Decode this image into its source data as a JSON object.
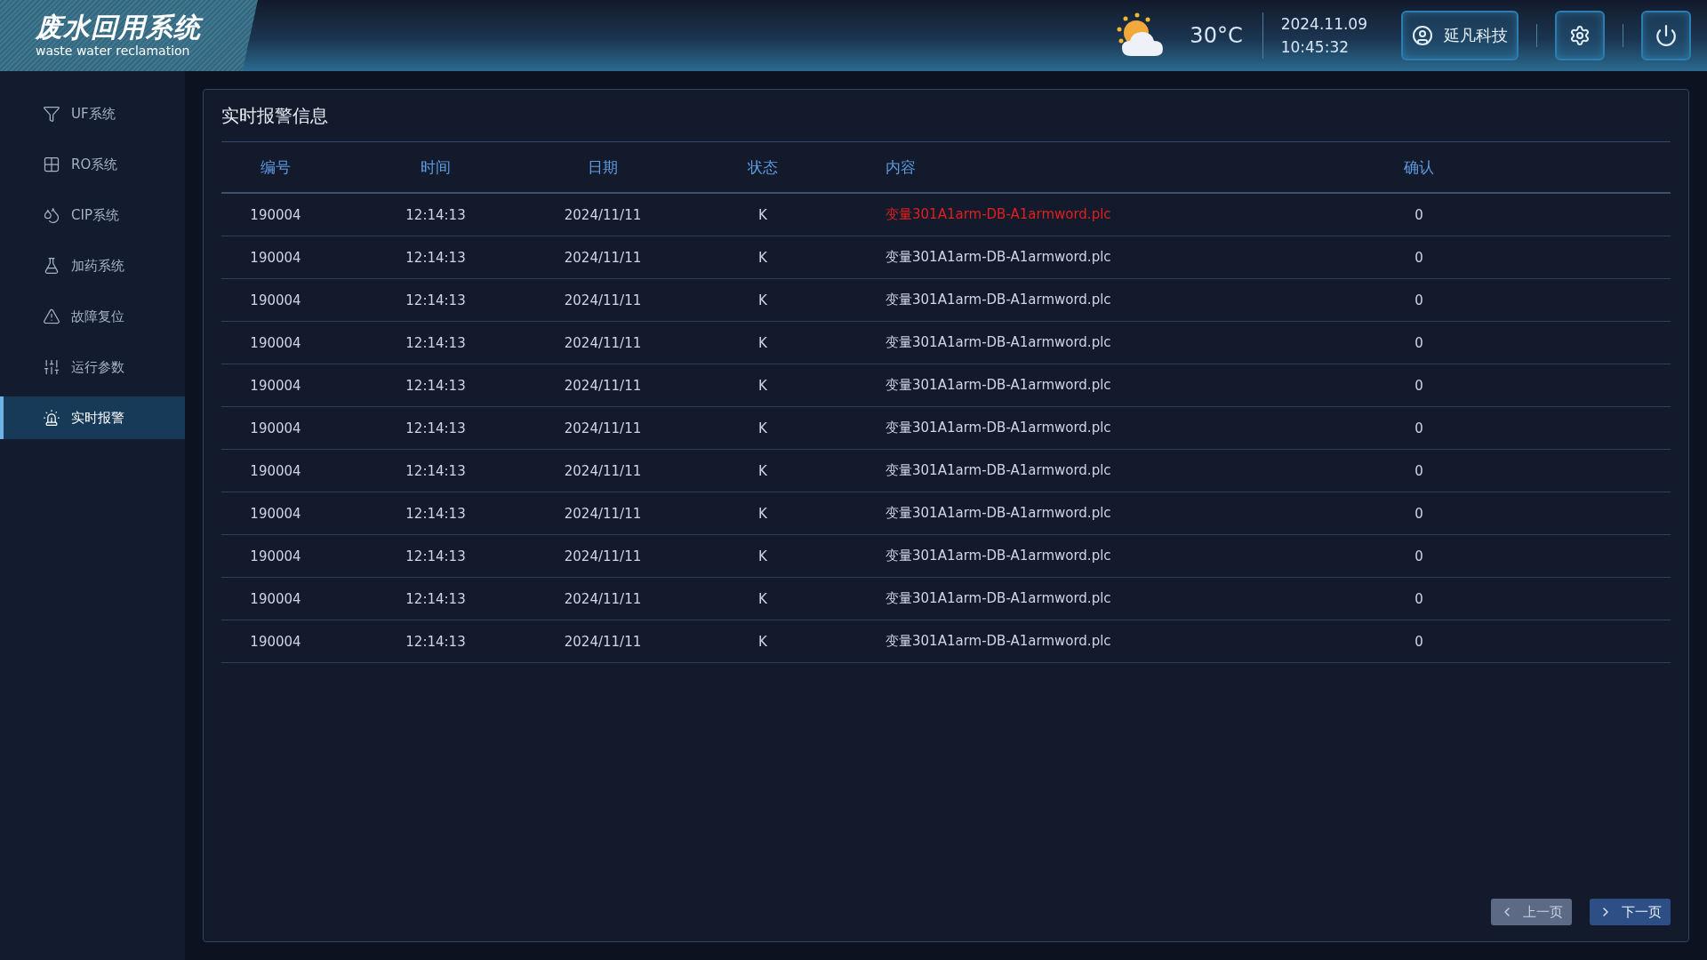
{
  "header": {
    "title": "废水回用系统",
    "subtitle": "waste water reclamation",
    "temperature": "30°C",
    "date": "2024.11.09",
    "time": "10:45:32",
    "user": "延凡科技"
  },
  "sidebar": {
    "items": [
      {
        "label": "UF系统",
        "kind": "filter",
        "selected": false
      },
      {
        "label": "RO系统",
        "kind": "membrane",
        "selected": false
      },
      {
        "label": "CIP系统",
        "kind": "drops",
        "selected": false
      },
      {
        "label": "加药系统",
        "kind": "flask",
        "selected": false
      },
      {
        "label": "故障复位",
        "kind": "warning",
        "selected": false
      },
      {
        "label": "运行参数",
        "kind": "sliders",
        "selected": false
      },
      {
        "label": "实时报警",
        "kind": "siren",
        "selected": true
      }
    ]
  },
  "panel": {
    "title": "实时报警信息",
    "table": {
      "columns": [
        "编号",
        "时间",
        "日期",
        "状态",
        "内容",
        "确认"
      ],
      "rows": [
        {
          "cells": [
            "190004",
            "12:14:13",
            "2024/11/11",
            "K",
            "变量301A1arm-DB-A1armword.plc",
            "0"
          ],
          "highlighted": true
        },
        {
          "cells": [
            "190004",
            "12:14:13",
            "2024/11/11",
            "K",
            "变量301A1arm-DB-A1armword.plc",
            "0"
          ],
          "highlighted": false
        },
        {
          "cells": [
            "190004",
            "12:14:13",
            "2024/11/11",
            "K",
            "变量301A1arm-DB-A1armword.plc",
            "0"
          ],
          "highlighted": false
        },
        {
          "cells": [
            "190004",
            "12:14:13",
            "2024/11/11",
            "K",
            "变量301A1arm-DB-A1armword.plc",
            "0"
          ],
          "highlighted": false
        },
        {
          "cells": [
            "190004",
            "12:14:13",
            "2024/11/11",
            "K",
            "变量301A1arm-DB-A1armword.plc",
            "0"
          ],
          "highlighted": false
        },
        {
          "cells": [
            "190004",
            "12:14:13",
            "2024/11/11",
            "K",
            "变量301A1arm-DB-A1armword.plc",
            "0"
          ],
          "highlighted": false
        },
        {
          "cells": [
            "190004",
            "12:14:13",
            "2024/11/11",
            "K",
            "变量301A1arm-DB-A1armword.plc",
            "0"
          ],
          "highlighted": false
        },
        {
          "cells": [
            "190004",
            "12:14:13",
            "2024/11/11",
            "K",
            "变量301A1arm-DB-A1armword.plc",
            "0"
          ],
          "highlighted": false
        },
        {
          "cells": [
            "190004",
            "12:14:13",
            "2024/11/11",
            "K",
            "变量301A1arm-DB-A1armword.plc",
            "0"
          ],
          "highlighted": false
        },
        {
          "cells": [
            "190004",
            "12:14:13",
            "2024/11/11",
            "K",
            "变量301A1arm-DB-A1armword.plc",
            "0"
          ],
          "highlighted": false
        },
        {
          "cells": [
            "190004",
            "12:14:13",
            "2024/11/11",
            "K",
            "变量301A1arm-DB-A1armword.plc",
            "0"
          ],
          "highlighted": false
        }
      ]
    },
    "pagination": [
      {
        "label": "上一页",
        "kind": "prev",
        "disabled": true
      },
      {
        "label": "下一页",
        "kind": "next",
        "disabled": false
      }
    ]
  }
}
